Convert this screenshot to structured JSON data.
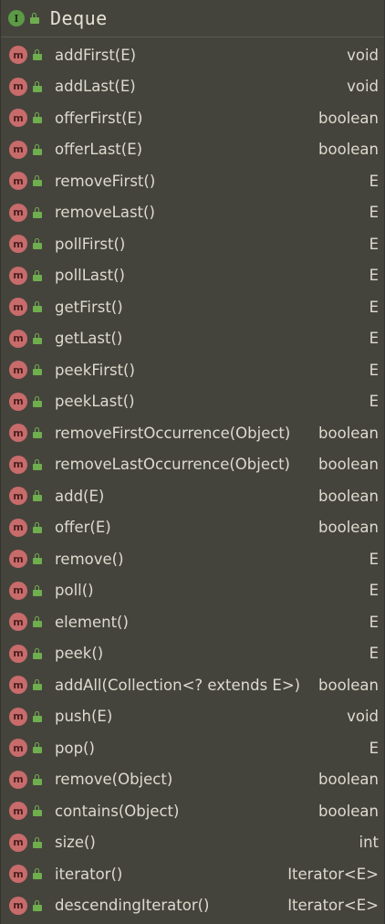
{
  "header": {
    "icon": "interface-icon",
    "badge_letter": "I",
    "title": "Deque"
  },
  "method_badge_letter": "m",
  "methods": [
    {
      "name": "addFirst(E)",
      "returns": "void"
    },
    {
      "name": "addLast(E)",
      "returns": "void"
    },
    {
      "name": "offerFirst(E)",
      "returns": "boolean"
    },
    {
      "name": "offerLast(E)",
      "returns": "boolean"
    },
    {
      "name": "removeFirst()",
      "returns": "E"
    },
    {
      "name": "removeLast()",
      "returns": "E"
    },
    {
      "name": "pollFirst()",
      "returns": "E"
    },
    {
      "name": "pollLast()",
      "returns": "E"
    },
    {
      "name": "getFirst()",
      "returns": "E"
    },
    {
      "name": "getLast()",
      "returns": "E"
    },
    {
      "name": "peekFirst()",
      "returns": "E"
    },
    {
      "name": "peekLast()",
      "returns": "E"
    },
    {
      "name": "removeFirstOccurrence(Object)",
      "returns": "boolean"
    },
    {
      "name": "removeLastOccurrence(Object)",
      "returns": "boolean"
    },
    {
      "name": "add(E)",
      "returns": "boolean"
    },
    {
      "name": "offer(E)",
      "returns": "boolean"
    },
    {
      "name": "remove()",
      "returns": "E"
    },
    {
      "name": "poll()",
      "returns": "E"
    },
    {
      "name": "element()",
      "returns": "E"
    },
    {
      "name": "peek()",
      "returns": "E"
    },
    {
      "name": "addAll(Collection<? extends E>)",
      "returns": "boolean"
    },
    {
      "name": "push(E)",
      "returns": "void"
    },
    {
      "name": "pop()",
      "returns": "E"
    },
    {
      "name": "remove(Object)",
      "returns": "boolean"
    },
    {
      "name": "contains(Object)",
      "returns": "boolean"
    },
    {
      "name": "size()",
      "returns": "int"
    },
    {
      "name": "iterator()",
      "returns": "Iterator<E>"
    },
    {
      "name": "descendingIterator()",
      "returns": "Iterator<E>"
    }
  ],
  "colors": {
    "background": "#45443c",
    "interface_badge": "#5c9a46",
    "method_badge": "#c86b6b",
    "public_lock": "#6fae4f",
    "text": "#dddbcf"
  }
}
